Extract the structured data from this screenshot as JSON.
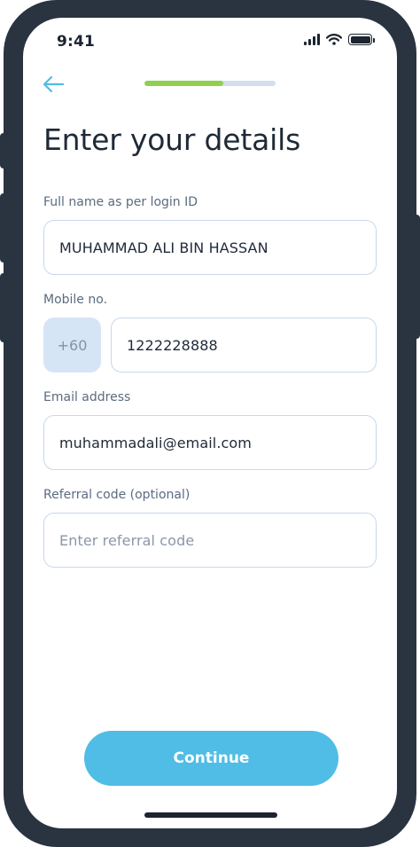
{
  "status_bar": {
    "time": "9:41"
  },
  "header": {
    "progress_fraction": 0.6
  },
  "page": {
    "title": "Enter your details"
  },
  "form": {
    "full_name": {
      "label": "Full name as per login ID",
      "value": "MUHAMMAD ALI BIN HASSAN"
    },
    "mobile": {
      "label": "Mobile no.",
      "country_code": "+60",
      "value": "1222228888"
    },
    "email": {
      "label": "Email address",
      "value": "muhammadali@email.com"
    },
    "referral": {
      "label": "Referral code (optional)",
      "placeholder": "Enter referral code",
      "value": ""
    }
  },
  "actions": {
    "continue_label": "Continue"
  },
  "colors": {
    "accent": "#4fbde6",
    "progress_done": "#8fd14f",
    "progress_track": "#d3dfef",
    "input_border": "#c7d8ec",
    "frame": "#2a3340"
  },
  "icons": {
    "back": "arrow-left-icon",
    "signal": "cellular-signal-icon",
    "wifi": "wifi-icon",
    "battery": "battery-icon"
  }
}
